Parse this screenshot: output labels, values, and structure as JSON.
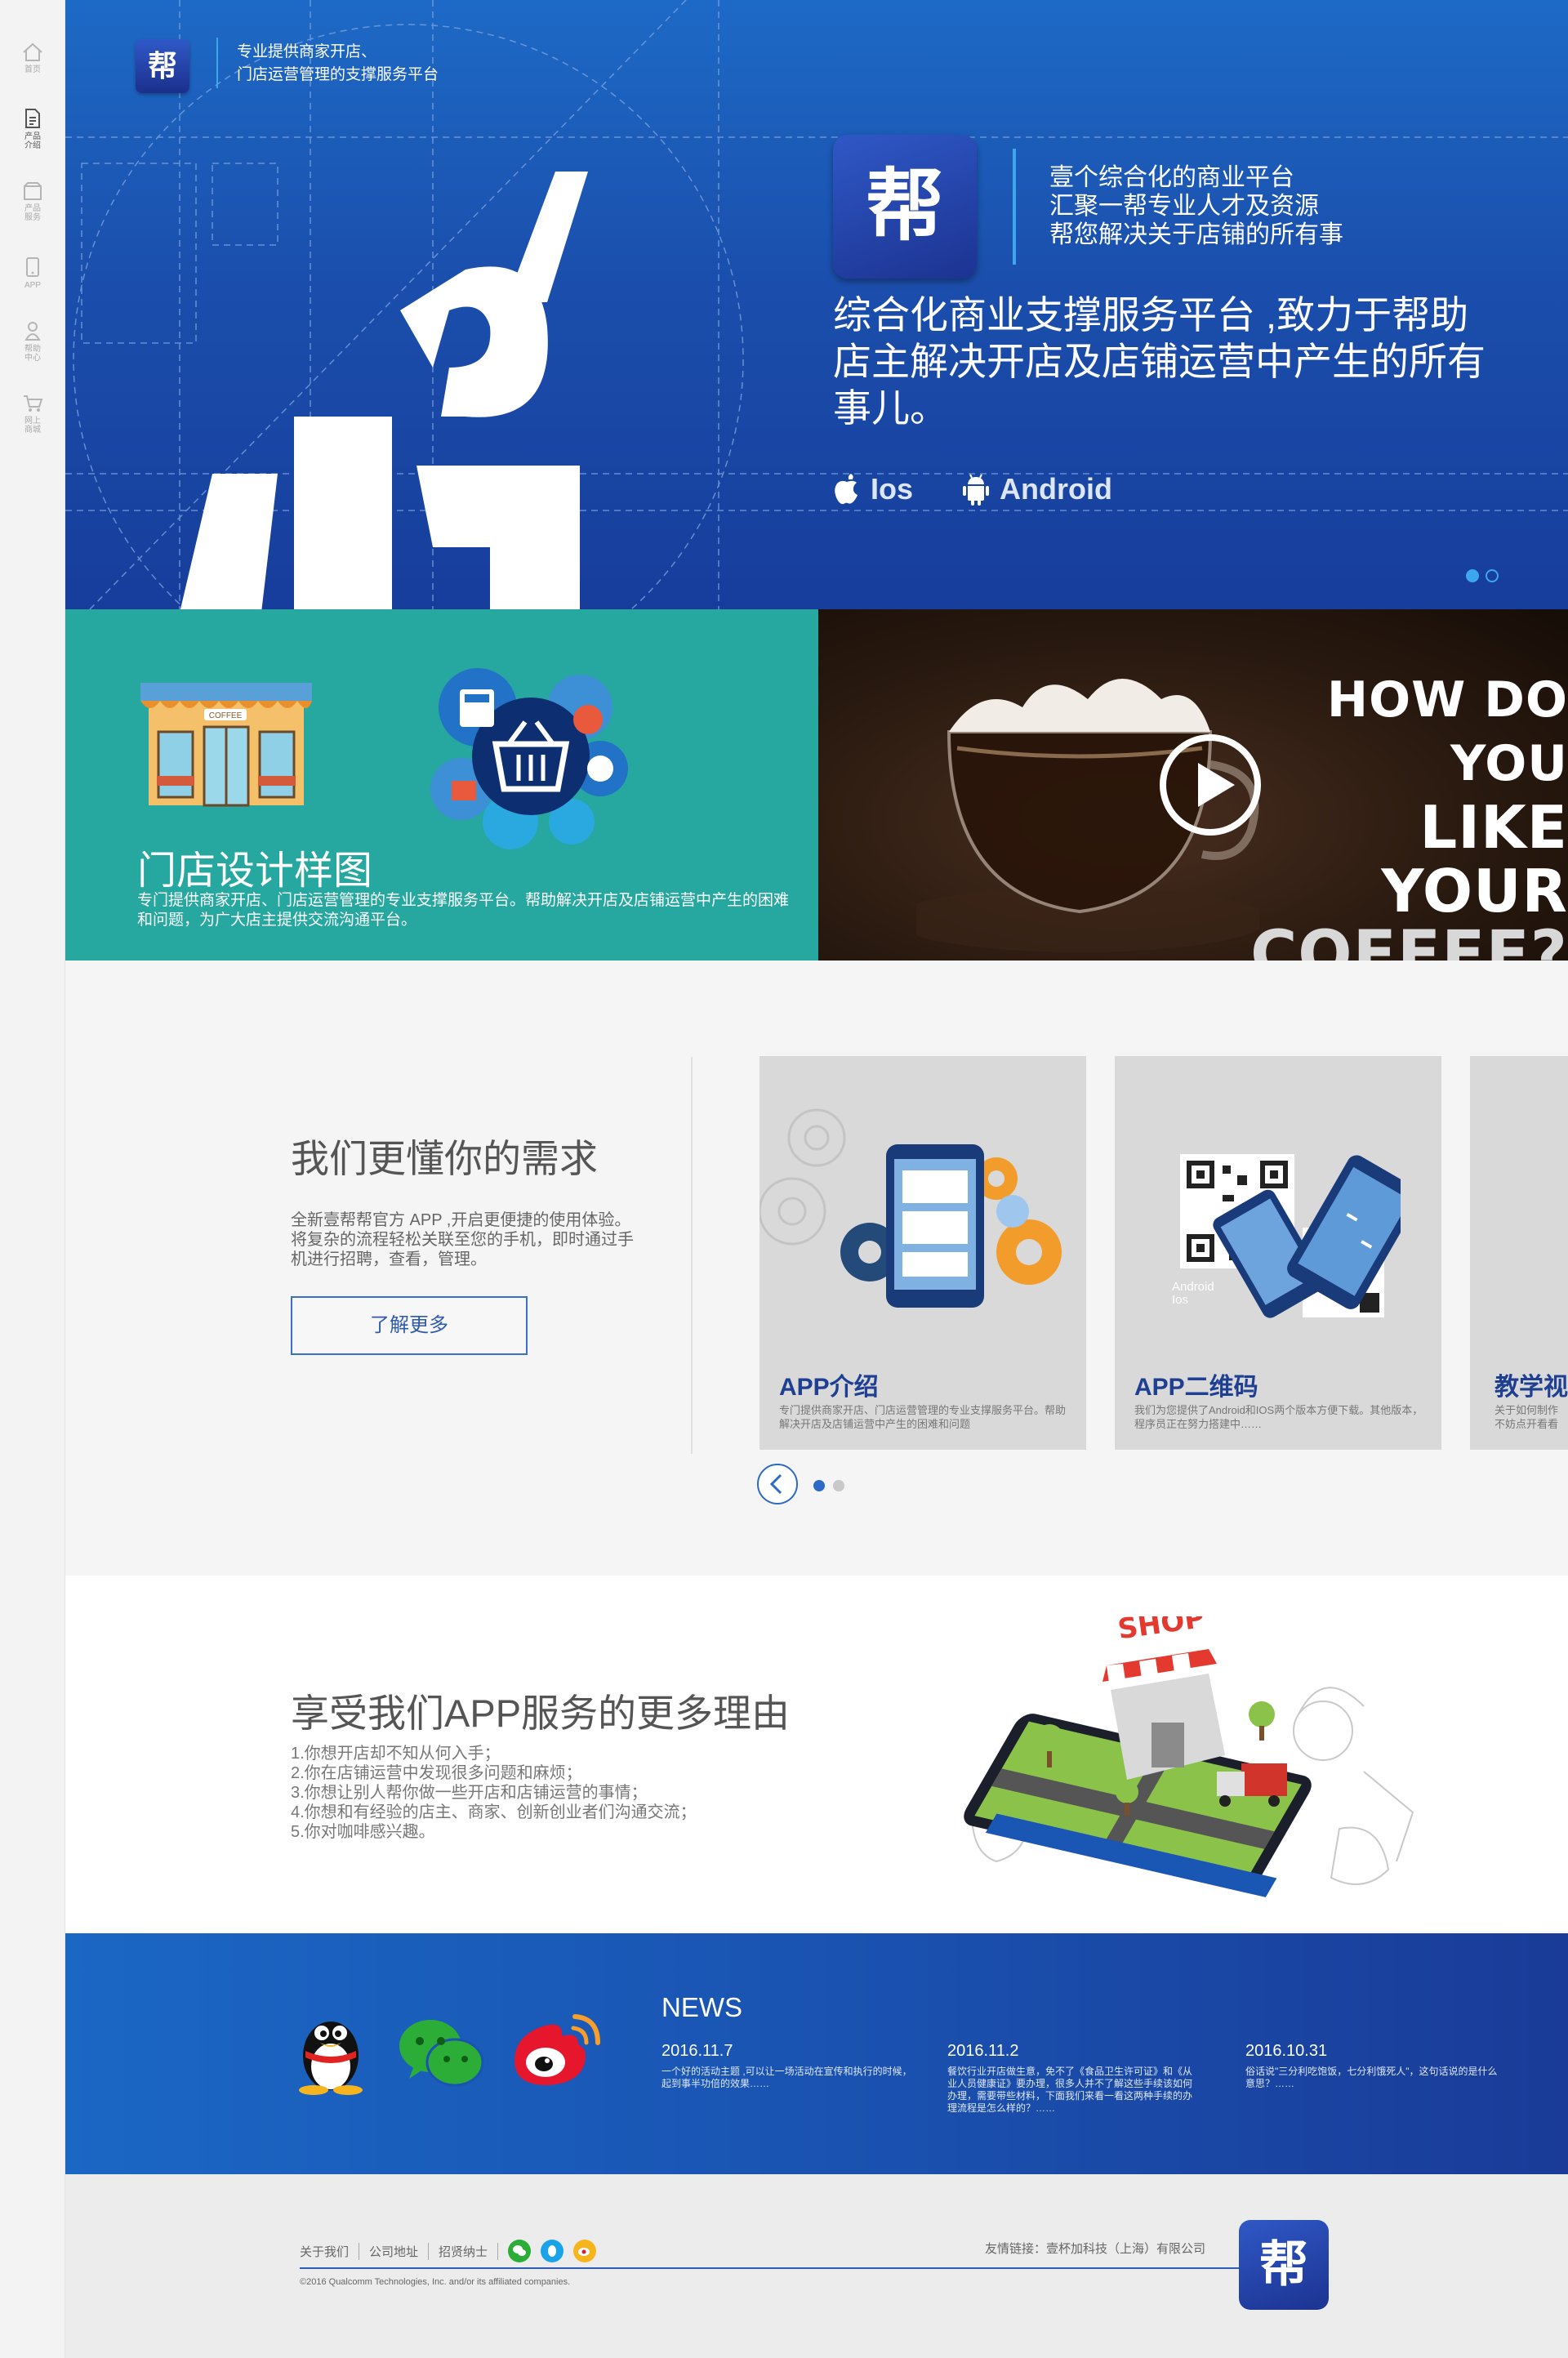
{
  "nav": {
    "items": [
      {
        "label": "首页",
        "icon": "home-icon"
      },
      {
        "label": "产品介绍",
        "icon": "document-icon"
      },
      {
        "label": "产品服务",
        "icon": "box-icon"
      },
      {
        "label": "APP",
        "icon": "phone-icon"
      },
      {
        "label": "帮助中心",
        "icon": "user-icon"
      },
      {
        "label": "网上商城",
        "icon": "cart-icon"
      }
    ]
  },
  "hero": {
    "logo_char": "帮",
    "tagline_line1": "专业提供商家开店、",
    "tagline_line2": "门店运营管理的支撑服务平台",
    "line1": "壹个综合化的商业平台",
    "line2": "汇聚一帮专业人才及资源",
    "line3": "帮您解决关于店铺的所有事",
    "description": "综合化商业支撑服务平台 ,致力于帮助店主解决开店及店铺运营中产生的所有事儿。",
    "ios_label": "Ios",
    "android_label": "Android",
    "slide_count": 2,
    "active_slide": 1
  },
  "feature": {
    "title": "门店设计样图",
    "description": "专门提供商家开店、门店运营管理的专业支撑服务平台。帮助解决开店及店铺运营中产生的困难和问题，为广大店主提供交流沟通平台。",
    "shop_sign": "COFFEE",
    "video": {
      "line1": "HOW DO YOU",
      "line2": "LIKE YOUR",
      "line3": "COFFEE?"
    }
  },
  "needs": {
    "title": "我们更懂你的需求",
    "description": "全新壹帮帮官方 APP ,开启更便捷的使用体验。将复杂的流程轻松关联至您的手机，即时通过手机进行招聘，查看，管理。",
    "button_label": "了解更多",
    "cards": [
      {
        "title": "APP介绍",
        "desc": "专门提供商家开店、门店运营管理的专业支撑服务平台。帮助解决开店及店铺运营中产生的困难和问题"
      },
      {
        "title": "APP二维码",
        "desc": "我们为您提供了Android和IOS两个版本方便下载。其他版本，程序员正在努力搭建中……",
        "qr_label1": "Android",
        "qr_label2": "Ios"
      },
      {
        "title": "教学视",
        "desc": "关于如何制作不妨点开看看"
      }
    ],
    "carousel_pages": 2,
    "active_page": 1
  },
  "reasons": {
    "title": "享受我们APP服务的更多理由",
    "items": [
      "1.你想开店却不知从何入手；",
      "2.你在店铺运营中发现很多问题和麻烦；",
      "3.你想让别人帮你做一些开店和店铺运营的事情；",
      "4.你想和有经验的店主、商家、创新创业者们沟通交流；",
      "5.你对咖啡感兴趣。"
    ],
    "shop_sign": "SHOP"
  },
  "news": {
    "heading": "NEWS",
    "items": [
      {
        "date": "2016.11.7",
        "text": "一个好的活动主题 ,可以让一场活动在宣传和执行的时候，起到事半功倍的效果……"
      },
      {
        "date": "2016.11.2",
        "text": "餐饮行业开店做生意，免不了《食品卫生许可证》和《从业人员健康证》要办理，很多人并不了解这些手续该如何办理，需要带些材料，下面我们来看一看这两种手续的办理流程是怎么样的？……"
      },
      {
        "date": "2016.10.31",
        "text": "俗话说\"三分利吃饱饭，七分利饿死人\"，这句话说的是什么意思？……"
      }
    ]
  },
  "footer": {
    "links": [
      "关于我们",
      "公司地址",
      "招贤纳士"
    ],
    "copyright": "©2016 Qualcomm Technologies, Inc. and/or its affiliated companies.",
    "partner_label": "友情链接：",
    "partner_name": "壹杯加科技（上海）有限公司",
    "logo_char": "帮"
  },
  "colors": {
    "brand_blue": "#1b4fad",
    "accent_cyan": "#3ca7ee",
    "teal": "#26a8a0",
    "logo_blue": "#1c3391"
  }
}
